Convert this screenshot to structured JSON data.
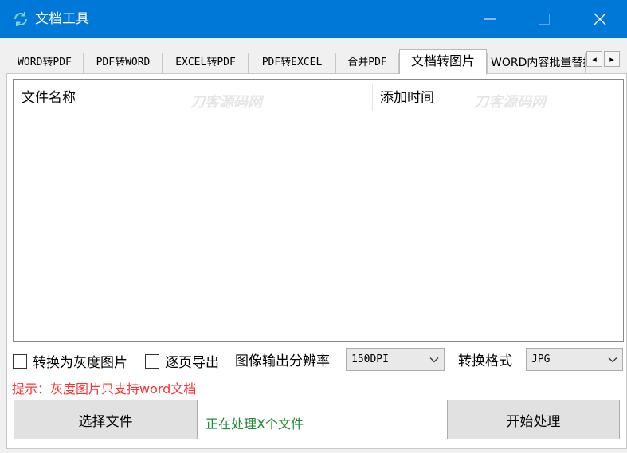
{
  "window": {
    "title": "文档工具",
    "icon": "refresh-icon",
    "controls": {
      "minimize": "minimize-icon",
      "maximize": "maximize-icon",
      "close": "close-icon"
    }
  },
  "tabs": [
    {
      "label": "WORD转PDF"
    },
    {
      "label": "PDF转WORD"
    },
    {
      "label": "EXCEL转PDF"
    },
    {
      "label": "PDF转EXCEL"
    },
    {
      "label": "合并PDF"
    },
    {
      "label": "文档转图片",
      "active": true
    },
    {
      "label": "WORD内容批量替换"
    }
  ],
  "tab_scroll": {
    "left": "◂",
    "right": "▸"
  },
  "list": {
    "columns": [
      "文件名称",
      "添加时间"
    ],
    "rows": []
  },
  "watermark": "刀客源码网",
  "options": {
    "grayscale_label": "转换为灰度图片",
    "grayscale_checked": false,
    "per_page_label": "逐页导出",
    "per_page_checked": false,
    "dpi_label": "图像输出分辨率",
    "dpi_value": "150DPI",
    "format_label": "转换格式",
    "format_value": "JPG"
  },
  "hint": "提示：灰度图片只支持word文档",
  "buttons": {
    "select_files": "选择文件",
    "start": "开始处理"
  },
  "status": "正在处理X个文件",
  "colors": {
    "titlebar": "#0078d7",
    "hint": "#ff3030",
    "status": "#1e8a32"
  }
}
